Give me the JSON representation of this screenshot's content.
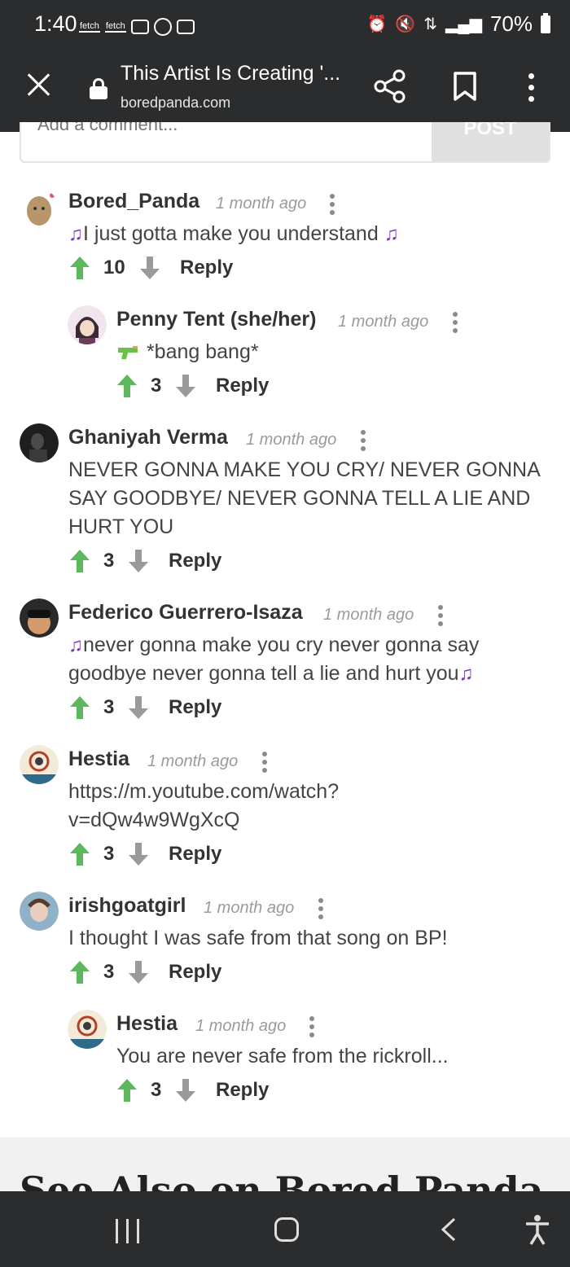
{
  "status_bar": {
    "time": "1:40",
    "left_icons": [
      "fetch-icon",
      "fetch-icon",
      "parking-icon",
      "at-icon",
      "gallery-icon"
    ],
    "left_labels": [
      "fetch",
      "fetch"
    ],
    "right_icons": [
      "alarm-icon",
      "mute-icon",
      "data-icon",
      "signal-icon"
    ],
    "battery": "70%"
  },
  "toolbar": {
    "title": "This Artist Is Creating '...",
    "url": "boredpanda.com",
    "close_icon": "close-icon",
    "lock_icon": "lock-icon",
    "share_icon": "share-icon",
    "bookmark_icon": "bookmark-icon",
    "menu_icon": "more-vert-icon"
  },
  "comment_form": {
    "placeholder": "Add a comment...",
    "post_label": "POST"
  },
  "comments": [
    {
      "author": "Bored_Panda",
      "time": "1 month ago",
      "text": "I just gotta make you understand",
      "votes": "10",
      "reply": "Reply"
    },
    {
      "author": "Penny Tent (she/her)",
      "time": "1 month ago",
      "text": "*bang bang*",
      "votes": "3",
      "reply": "Reply"
    },
    {
      "author": "Ghaniyah Verma",
      "time": "1 month ago",
      "text": "NEVER GONNA MAKE YOU CRY/ NEVER GONNA SAY GOODBYE/ NEVER GONNA TELL A LIE AND HURT YOU",
      "votes": "3",
      "reply": "Reply"
    },
    {
      "author": "Federico Guerrero-Isaza",
      "time": "1 month ago",
      "text": "never gonna make you cry never gonna say goodbye never gonna tell a lie and hurt you",
      "votes": "3",
      "reply": "Reply"
    },
    {
      "author": "Hestia",
      "time": "1 month ago",
      "text_line1": "https://m.youtube.com/watch?",
      "text_line2": "v=dQw4w9WgXcQ",
      "votes": "3",
      "reply": "Reply"
    },
    {
      "author": "irishgoatgirl",
      "time": "1 month ago",
      "text": "I thought I was safe from that song on BP!",
      "votes": "3",
      "reply": "Reply"
    },
    {
      "author": "Hestia",
      "time": "1 month ago",
      "text": "You are never safe from the rickroll...",
      "votes": "3",
      "reply": "Reply"
    }
  ],
  "see_also": "See Also on Bored Panda",
  "colors": {
    "upvote": "#5cb85c",
    "downvote": "#9a9a9a",
    "music_note": "#7a37b8",
    "bar_bg": "#2b2c2e"
  }
}
